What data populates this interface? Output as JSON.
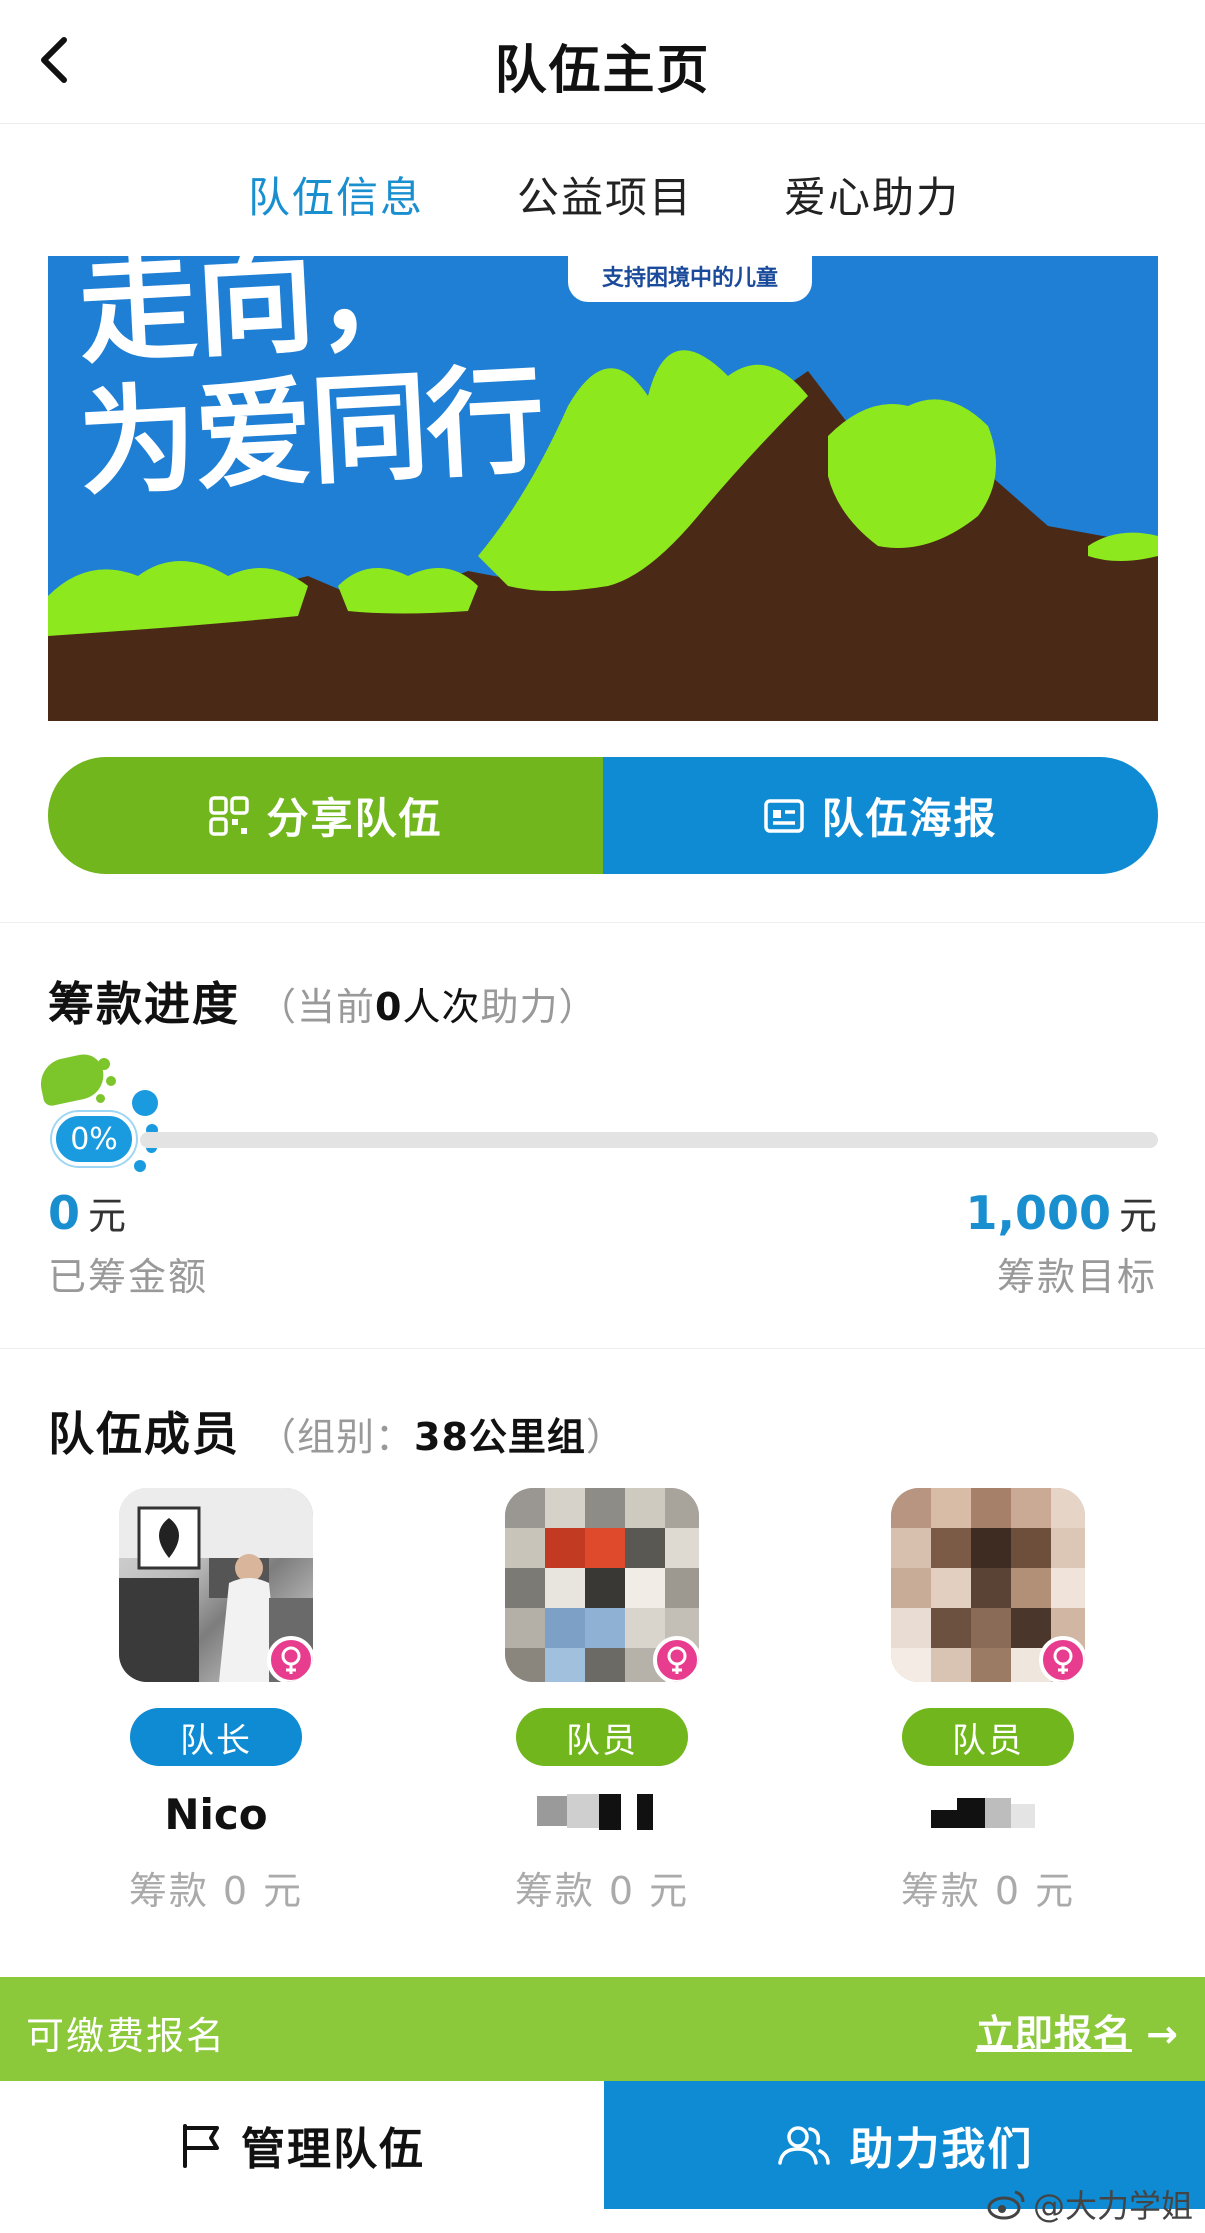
{
  "header": {
    "title": "队伍主页"
  },
  "tabs": [
    "队伍信息",
    "公益项目",
    "爱心助力"
  ],
  "banner": {
    "line1": "走向，",
    "line2": "为爱同行",
    "tag": "支持困境中的儿童"
  },
  "actions": {
    "share_label": "分享队伍",
    "poster_label": "队伍海报"
  },
  "fundraising": {
    "title": "筹款进度",
    "sub_prefix": "（当前",
    "sub_count": "0",
    "sub_mid": "人次",
    "sub_suffix": "助力）",
    "percent_label": "0%",
    "progress": 0,
    "raised_value": "0",
    "raised_unit": "元",
    "raised_caption": "已筹金额",
    "goal_value": "1,000",
    "goal_unit": "元",
    "goal_caption": "筹款目标"
  },
  "members": {
    "title": "队伍成员",
    "sub_prefix": "（组别：",
    "group": "38公里组",
    "sub_suffix": "）",
    "list": [
      {
        "role": "队长",
        "name": "Nico",
        "raised": "筹款 0 元"
      },
      {
        "role": "队员",
        "name": "",
        "raised": "筹款 0 元"
      },
      {
        "role": "队员",
        "name": "",
        "raised": "筹款 0 元"
      }
    ]
  },
  "signup": {
    "left": "可缴费报名",
    "right": "立即报名"
  },
  "bottom": {
    "manage_label": "管理队伍",
    "support_label": "助力我们"
  },
  "watermark": "@大力学姐",
  "colors": {
    "blue": "#0e8bd3",
    "green": "#70b61c",
    "signup_green": "#8bc83a",
    "pink": "#e83d8e"
  }
}
